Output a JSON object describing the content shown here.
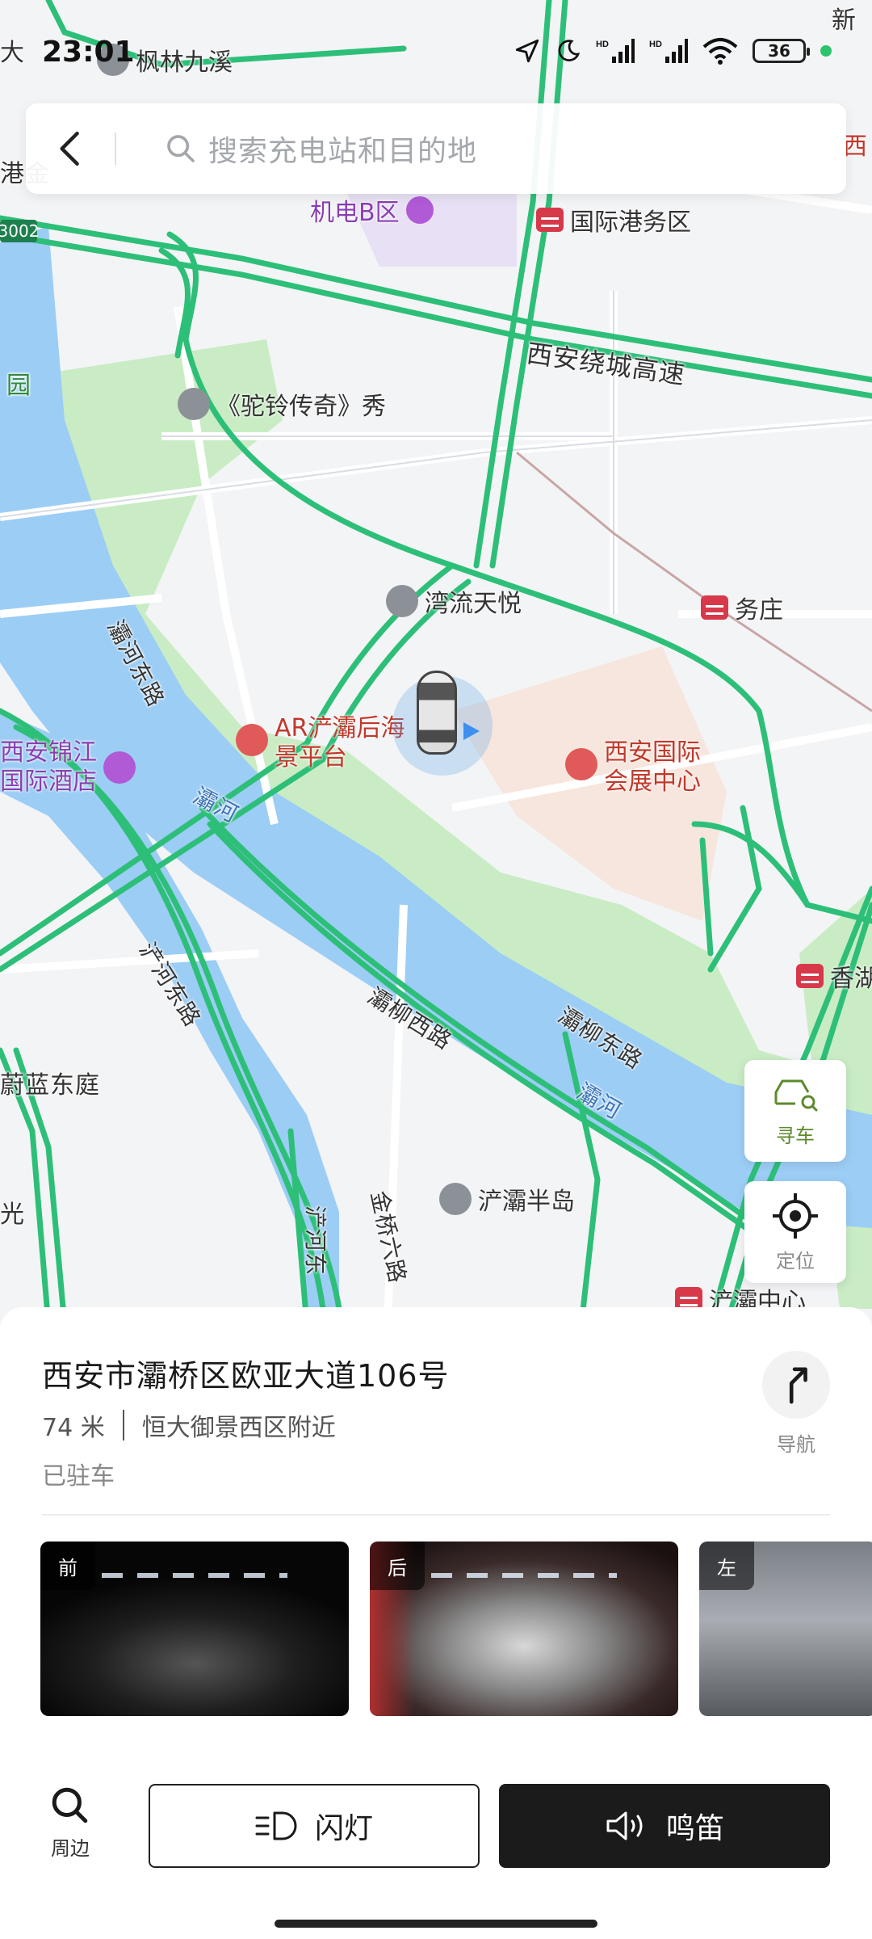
{
  "status_bar": {
    "time": "23:01",
    "battery": "36",
    "network_1": "HD",
    "network_2": "HD"
  },
  "search": {
    "placeholder": "搜索充电站和目的地"
  },
  "map": {
    "labels": {
      "fenglin": "枫林九溪",
      "jidian": "机电B区",
      "guojigang": "国际港务区",
      "raocheng": "西安绕城高速",
      "tuoling": "《驼铃传奇》秀",
      "wanliu": "湾流天悦",
      "wuzhuang": "务庄",
      "baheEast": "灞河东路",
      "ar_line1": "AR浐灞后海",
      "ar_line2": "景平台",
      "expo_line1": "西安国际",
      "expo_line2": "会展中心",
      "jinjiang_line1": "西安锦江",
      "jinjiang_line2": "国际酒店",
      "bahe_river": "灞河",
      "chanhe_east": "浐河东路",
      "baliu_west": "灞柳西路",
      "baliu_east": "灞柳东路",
      "bahe_river2": "灞河",
      "xianghu": "香湖",
      "weilan": "蔚蓝东庭",
      "chanba_peninsula": "浐灞半岛",
      "jinqiao": "金桥六路",
      "chanhe_east2": "浐河东",
      "chanba_center": "浐灞中心",
      "guang": "光",
      "yuan": "园",
      "gangjin": "港金",
      "xi": "西",
      "da": "大",
      "xin": "新",
      "road_code": "3002"
    }
  },
  "buttons": {
    "find_car": "寻车",
    "locate": "定位"
  },
  "sheet": {
    "address": "西安市灞桥区欧亚大道106号",
    "distance": "74 米",
    "near": "恒大御景西区附近",
    "parked": "已驻车",
    "navigate": "导航",
    "cameras": [
      "前",
      "后",
      "左"
    ],
    "nearby": "周边",
    "flash": "闪灯",
    "honk": "鸣笛"
  }
}
